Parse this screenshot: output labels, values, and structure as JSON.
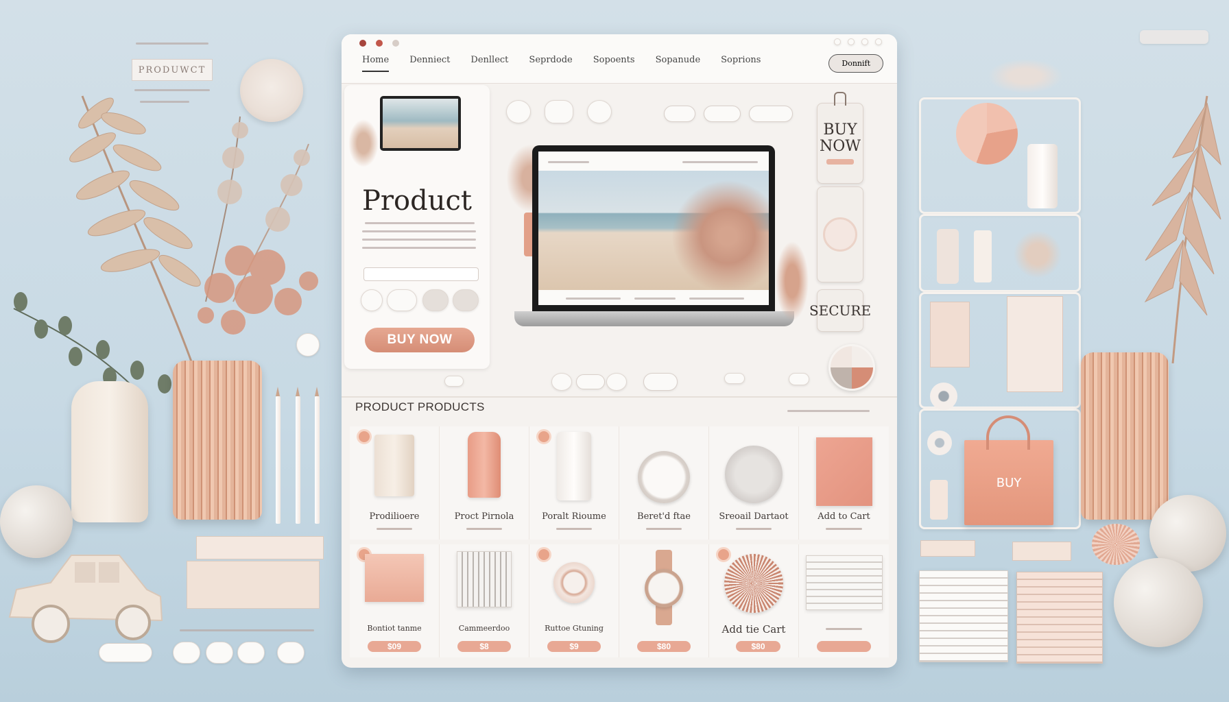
{
  "left_tag": {
    "label": "PRODUWCT"
  },
  "nav": {
    "links": [
      "Home",
      "Denniect",
      "Denllect",
      "Seprdode",
      "Sopoents",
      "Sopanude",
      "Soprions"
    ],
    "button": "Donnift"
  },
  "hero": {
    "title": "Product",
    "buy_button": "BUY NOW"
  },
  "side_cards": {
    "buy_now": "BUY NOW",
    "secure": "SECURE"
  },
  "products_section": {
    "title": "PRODUCT PRODUCTS",
    "row1": [
      {
        "name": "Prodilioere"
      },
      {
        "name": "Proct Pirnola"
      },
      {
        "name": "Poralt Rioume"
      },
      {
        "name": "Beret'd ftae"
      },
      {
        "name": "Sreoail Dartaot"
      },
      {
        "name": "Add to Cart"
      }
    ],
    "row2": [
      {
        "name": "Bontiot tanme",
        "price": "$09"
      },
      {
        "name": "Cammeerdoo",
        "price": "$8"
      },
      {
        "name": "Ruttoe Gtuning",
        "price": "$9"
      },
      {
        "name": "",
        "price": "$80"
      },
      {
        "name": "Add tie Cart",
        "price": "$80"
      },
      {
        "name": "",
        "price": ""
      }
    ]
  },
  "shopping_bag": {
    "label": "BUY"
  },
  "colors": {
    "accent": "#d98e77",
    "background": "#c9dbe5",
    "panel": "#f5f2ef"
  }
}
